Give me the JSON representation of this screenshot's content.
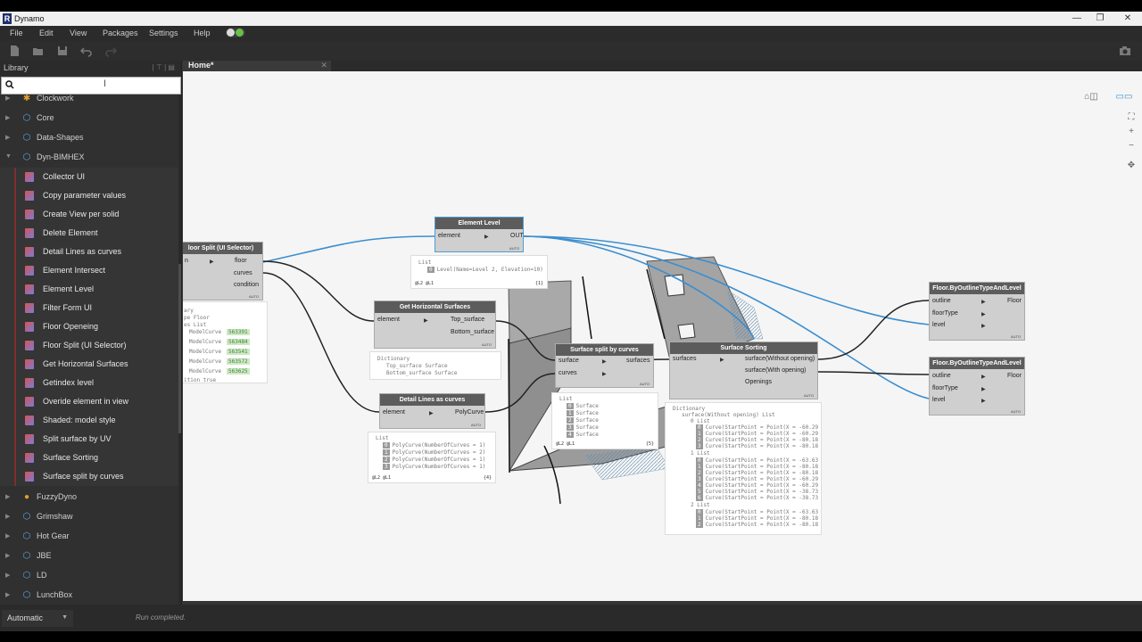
{
  "window": {
    "title": "Dynamo",
    "logo": "R",
    "minimize": "—",
    "maximize": "❐",
    "close": "✕"
  },
  "menu": [
    "File",
    "Edit",
    "View",
    "Packages",
    "Settings",
    "Help"
  ],
  "toolbar": {
    "icons": [
      "new-file-icon",
      "open-icon",
      "save-icon",
      "undo-icon",
      "redo-icon"
    ],
    "right_icon": "camera-icon"
  },
  "library": {
    "title": "Library",
    "header_icons": "| ⊤ | ▤",
    "search": {
      "value": "",
      "placeholder": ""
    },
    "categories_top": [
      {
        "label": "Clockwork",
        "icon": "clockwork-icon"
      },
      {
        "label": "Core",
        "icon": "package-icon"
      },
      {
        "label": "Data-Shapes",
        "icon": "package-icon"
      },
      {
        "label": "Dyn-BIMHEX",
        "icon": "package-icon",
        "expanded": true
      }
    ],
    "subitems": [
      "Collector UI",
      "Copy parameter values",
      "Create View per solid",
      "Delete Element",
      "Detail Lines as curves",
      "Element Intersect",
      "Element Level",
      "Filter Form UI",
      "Floor Openeing",
      "Floor Split (UI Selector)",
      "Get Horizontal Surfaces",
      "Getindex level",
      "Overide element in view",
      "Shaded: model style",
      "Split surface by UV",
      "Surface Sorting",
      "Surface split by curves"
    ],
    "categories_bottom": [
      {
        "label": "FuzzyDyno",
        "icon": "person-icon"
      },
      {
        "label": "Grimshaw",
        "icon": "package-icon"
      },
      {
        "label": "Hot Gear",
        "icon": "package-icon"
      },
      {
        "label": "JBE",
        "icon": "package-icon"
      },
      {
        "label": "LD",
        "icon": "package-icon"
      },
      {
        "label": "LunchBox",
        "icon": "package-icon"
      }
    ]
  },
  "tab": {
    "label": "Home*",
    "close": "✕"
  },
  "nodes": {
    "floor_split": {
      "title": "loor Split (UI Selector)",
      "inputs": [
        "n"
      ],
      "outputs": [
        "floor",
        "curves",
        "condition"
      ],
      "auto": "AUTO"
    },
    "element_level": {
      "title": "Element Level",
      "inputs": [
        "element"
      ],
      "outputs": [
        "OUT"
      ],
      "auto": "AUTO"
    },
    "get_horizontal": {
      "title": "Get Horizontal Surfaces",
      "inputs": [
        "element"
      ],
      "outputs": [
        "Top_surface",
        "Bottom_surface"
      ],
      "auto": "AUTO"
    },
    "detail_lines": {
      "title": "Detail Lines as curves",
      "inputs": [
        "element"
      ],
      "outputs": [
        "PolyCurve"
      ],
      "auto": "AUTO"
    },
    "split_curves": {
      "title": "Surface split by curves",
      "inputs": [
        "surface",
        "curves"
      ],
      "outputs": [
        "surfaces"
      ],
      "auto": "AUTO"
    },
    "surface_sorting": {
      "title": "Surface Sorting",
      "inputs": [
        "surfaces"
      ],
      "outputs": [
        "surface(Without opening)",
        "surface(With opening)",
        "Openings"
      ],
      "auto": "AUTO"
    },
    "floor1": {
      "title": "Floor.ByOutlineTypeAndLevel",
      "inputs": [
        "outline",
        "floorType",
        "level"
      ],
      "outputs": [
        "Floor"
      ],
      "auto": "AUTO"
    },
    "floor2": {
      "title": "Floor.ByOutlineTypeAndLevel",
      "inputs": [
        "outline",
        "floorType",
        "level"
      ],
      "outputs": [
        "Floor"
      ],
      "auto": "AUTO"
    }
  },
  "previews": {
    "element_level": {
      "lines": [
        "List",
        "Level(Name=Level 2, Elevation=10)"
      ],
      "idx": [
        "0"
      ],
      "foot": "@L2 @L1",
      "count": "{1}"
    },
    "floor_split": {
      "lines": [
        "ary",
        "pe Floor",
        "es List",
        "ModelCurve",
        "ModelCurve",
        "ModelCurve",
        "ModelCurve",
        "ModelCurve",
        "ition true"
      ],
      "ids": [
        "563391",
        "563484",
        "563541",
        "563572",
        "563625"
      ]
    },
    "get_horizontal": {
      "lines": [
        "Dictionary",
        "Top_surface Surface",
        "Bottom_surface Surface"
      ]
    },
    "detail_lines": {
      "lines": [
        "List",
        "PolyCurve(NumberOfCurves = 1)",
        "PolyCurve(NumberOfCurves = 2)",
        "PolyCurve(NumberOfCurves = 1)",
        "PolyCurve(NumberOfCurves = 1)"
      ],
      "idx": [
        "0",
        "1",
        "2",
        "3"
      ],
      "foot": "@L2 @L1",
      "count": "{4}"
    },
    "split_curves": {
      "lines": [
        "List",
        "Surface",
        "Surface",
        "Surface",
        "Surface",
        "Surface"
      ],
      "idx": [
        "0",
        "1",
        "2",
        "3",
        "4"
      ],
      "foot": "@L2 @L1",
      "count": "{5}"
    },
    "surface_sorting": {
      "lines": [
        "Dictionary",
        "surface(Without opening) List",
        "0 List",
        "Curve(StartPoint = Point(X = -60.29",
        "Curve(StartPoint = Point(X = -60.29",
        "Curve(StartPoint = Point(X = -80.18",
        "Curve(StartPoint = Point(X = -80.18",
        "1 List",
        "Curve(StartPoint = Point(X = -63.63",
        "Curve(StartPoint = Point(X = -80.18",
        "Curve(StartPoint = Point(X = -80.18",
        "Curve(StartPoint = Point(X = -60.29",
        "Curve(StartPoint = Point(X = -60.29",
        "Curve(StartPoint = Point(X = -38.73",
        "Curve(StartPoint = Point(X = -38.73",
        "2 List",
        "Curve(StartPoint = Point(X = -63.63",
        "Curve(StartPoint = Point(X = -80.18",
        "Curve(StartPoint = Point(X = -80.18"
      ],
      "idx": [
        "0",
        "1",
        "2",
        "3",
        "0",
        "1",
        "2",
        "3",
        "4",
        "5",
        "6",
        "0",
        "1",
        "2"
      ]
    }
  },
  "status": {
    "run_mode": "Automatic",
    "message": "Run completed."
  },
  "colors": {
    "wire_blue": "#3a8ed0",
    "wire_dark": "#222222",
    "node_header": "#5c5c5c",
    "canvas_bg": "#f5f5f5",
    "library_bar": "#7b2f2f"
  }
}
